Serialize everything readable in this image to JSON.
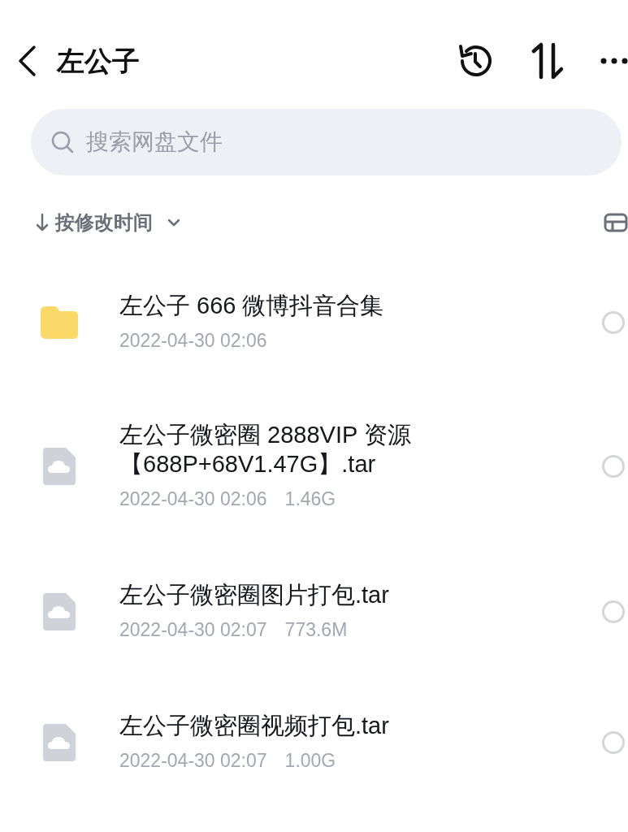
{
  "header": {
    "title": "左公子"
  },
  "search": {
    "placeholder": "搜索网盘文件"
  },
  "sort": {
    "label": "按修改时间"
  },
  "files": [
    {
      "kind": "folder",
      "name": "左公子 666 微博抖音合集",
      "date": "2022-04-30 02:06",
      "selected": false
    },
    {
      "kind": "file",
      "name": "左公子微密圈 2888VIP 资源【688P+68V1.47G】.tar",
      "date": "2022-04-30 02:06",
      "size": "1.46G",
      "selected": false
    },
    {
      "kind": "file",
      "name": "左公子微密圈图片打包.tar",
      "date": "2022-04-30 02:07",
      "size": "773.6M",
      "selected": false
    },
    {
      "kind": "file",
      "name": "左公子微密圈视频打包.tar",
      "date": "2022-04-30 02:07",
      "size": "1.00G",
      "selected": false
    }
  ]
}
